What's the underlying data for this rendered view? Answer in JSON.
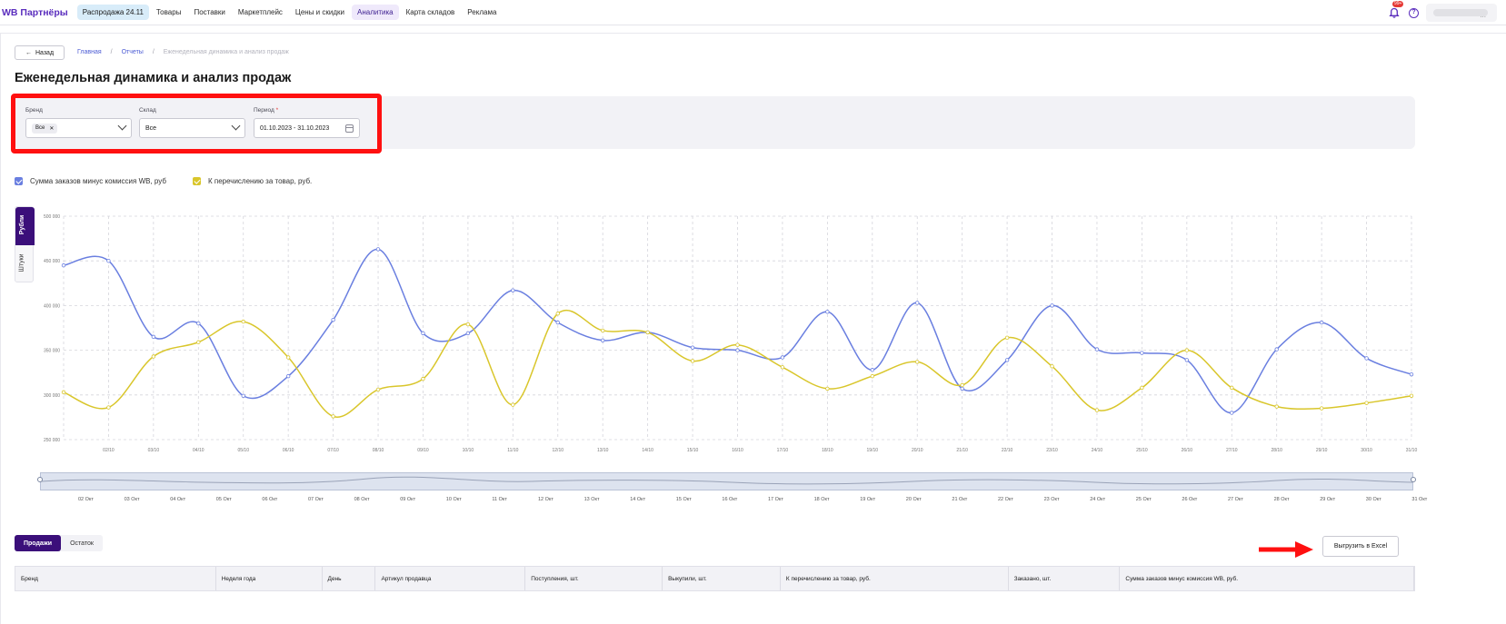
{
  "app": {
    "logo": "WB Партнёры",
    "nav": [
      {
        "label": "Распродажа 24.11",
        "style": "promo"
      },
      {
        "label": "Товары",
        "style": ""
      },
      {
        "label": "Поставки",
        "style": ""
      },
      {
        "label": "Маркетплейс",
        "style": ""
      },
      {
        "label": "Цены и скидки",
        "style": ""
      },
      {
        "label": "Аналитика",
        "style": "active"
      },
      {
        "label": "Карта складов",
        "style": ""
      },
      {
        "label": "Реклама",
        "style": ""
      }
    ],
    "bell_badge": "99+",
    "user_menu": "..."
  },
  "breadcrumbs": {
    "back": "Назад",
    "items": [
      "Главная",
      "Отчеты",
      "Еженедельная динамика и анализ продаж"
    ]
  },
  "page_title": "Еженедельная динамика и анализ продаж",
  "filters": {
    "brand_label": "Бренд",
    "brand_chip": "Все",
    "warehouse_label": "Склад",
    "warehouse_value": "Все",
    "period_label": "Период",
    "period_value": "01.10.2023 - 31.10.2023"
  },
  "legend": {
    "series1": "Сумма заказов минус комиссия WB, руб",
    "series2": "К перечислению за товар, руб."
  },
  "chart_toggle": {
    "on": "Рубли",
    "off": "Штуки"
  },
  "colors": {
    "series1": "#6a7fe0",
    "series2": "#d9c62b",
    "accent": "#3b0f7a"
  },
  "chart_data": {
    "type": "line",
    "x": [
      "01/10",
      "02/10",
      "03/10",
      "04/10",
      "05/10",
      "06/10",
      "07/10",
      "08/10",
      "09/10",
      "10/10",
      "11/10",
      "12/10",
      "13/10",
      "14/10",
      "15/10",
      "16/10",
      "17/10",
      "18/10",
      "19/10",
      "20/10",
      "21/10",
      "22/10",
      "23/10",
      "24/10",
      "25/10",
      "26/10",
      "27/10",
      "28/10",
      "29/10",
      "30/10",
      "31/10"
    ],
    "ytick_labels": [
      "250 000",
      "300 000",
      "350 000",
      "400 000",
      "450 000",
      "500 000"
    ],
    "ylim": [
      250000,
      500000
    ],
    "grid": true,
    "series": [
      {
        "name": "Сумма заказов минус комиссия WB, руб",
        "values": [
          445000,
          450000,
          365000,
          380000,
          299000,
          321000,
          384000,
          463000,
          369000,
          369000,
          417000,
          381000,
          361000,
          370000,
          353000,
          350000,
          342000,
          393000,
          328000,
          403000,
          307000,
          339000,
          400000,
          351000,
          347000,
          339000,
          280000,
          351000,
          381000,
          341000,
          323000
        ]
      },
      {
        "name": "К перечислению за товар, руб.",
        "values": [
          303000,
          286000,
          343000,
          359000,
          382000,
          342000,
          276000,
          306000,
          318000,
          379000,
          289000,
          391000,
          372000,
          370000,
          338000,
          356000,
          331000,
          307000,
          321000,
          337000,
          311000,
          364000,
          332000,
          283000,
          308000,
          350000,
          308000,
          287000,
          285000,
          291000,
          299000
        ]
      }
    ]
  },
  "zoom_labels": [
    "02 Окт",
    "03 Окт",
    "04 Окт",
    "05 Окт",
    "06 Окт",
    "07 Окт",
    "08 Окт",
    "09 Окт",
    "10 Окт",
    "11 Окт",
    "12 Окт",
    "13 Окт",
    "14 Окт",
    "15 Окт",
    "16 Окт",
    "17 Окт",
    "18 Окт",
    "19 Окт",
    "20 Окт",
    "21 Окт",
    "22 Окт",
    "23 Окт",
    "24 Окт",
    "25 Окт",
    "26 Окт",
    "27 Окт",
    "28 Окт",
    "29 Окт",
    "30 Окт",
    "31 Окт"
  ],
  "tabs": [
    "Продажи",
    "Остаток"
  ],
  "excel_button": "Выгрузить в Excel",
  "table_headers": [
    "Бренд",
    "Неделя года",
    "День",
    "Артикул продавца",
    "Поступления, шт.",
    "Выкупили, шт.",
    "К перечислению за товар, руб.",
    "Заказано, шт.",
    "Сумма заказов минус комиссия WB, руб."
  ]
}
